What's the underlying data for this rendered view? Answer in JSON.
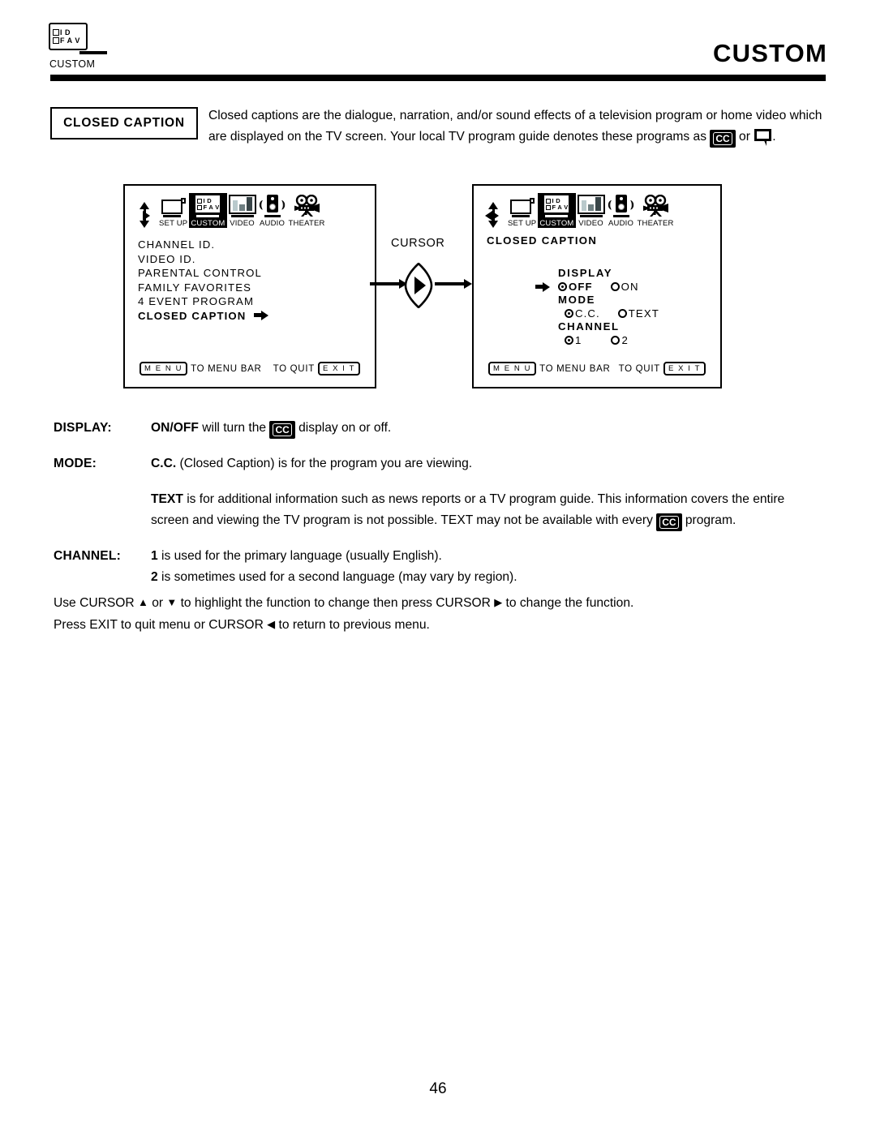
{
  "header": {
    "icon_name": "custom-tv-icon",
    "icon_rows": [
      {
        "label": "I D"
      },
      {
        "label": "F A V"
      }
    ],
    "icon_caption": "CUSTOM",
    "title": "CUSTOM"
  },
  "intro": {
    "tag_label": "CLOSED CAPTION",
    "text_part1": "Closed captions are the dialogue, narration, and/or sound effects of a television program or home video which are displayed on the TV screen.  Your local TV program guide denotes these programs as ",
    "cc_badge": "CC",
    "text_part2": " or ",
    "text_part3": "."
  },
  "menu_bar": {
    "items": [
      {
        "label": "SET UP",
        "icon": "tv-setup-icon",
        "selected": false
      },
      {
        "label": "CUSTOM",
        "icon": "custom-tv-icon",
        "selected": true
      },
      {
        "label": "VIDEO",
        "icon": "video-bars-icon",
        "selected": false
      },
      {
        "label": "AUDIO",
        "icon": "speaker-icon",
        "selected": false
      },
      {
        "label": "THEATER",
        "icon": "film-projector-icon",
        "selected": false
      }
    ],
    "cursor_pad_icon": "cursor-pad-icon"
  },
  "screen_left": {
    "name": "custom-menu-screen",
    "rows": [
      {
        "label": "CHANNEL ID.",
        "current": false,
        "arrow": false
      },
      {
        "label": "VIDEO ID.",
        "current": false,
        "arrow": false
      },
      {
        "label": "PARENTAL CONTROL",
        "current": false,
        "arrow": false
      },
      {
        "label": "FAMILY FAVORITES",
        "current": false,
        "arrow": false
      },
      {
        "label": "4 EVENT PROGRAM",
        "current": false,
        "arrow": false
      },
      {
        "label": "CLOSED CAPTION",
        "current": true,
        "arrow": true
      }
    ],
    "bottom": {
      "menu_key": "M E N U",
      "menu_text": "TO MENU BAR",
      "quit_text": "TO QUIT",
      "exit_key": "E X I T"
    }
  },
  "transition": {
    "label": "CURSOR",
    "lens_icon": "cursor-right-lens-icon",
    "arrow_in": "arrow-right-icon",
    "arrow_out": "arrow-right-icon"
  },
  "screen_right": {
    "name": "closed-caption-settings-screen",
    "title": "CLOSED CAPTION",
    "groups": [
      {
        "label": "DISPLAY",
        "pointer": true,
        "options": [
          {
            "label": "OFF",
            "selected": true,
            "bold": true
          },
          {
            "label": "ON",
            "selected": false,
            "bold": false
          }
        ]
      },
      {
        "label": "MODE",
        "pointer": false,
        "options": [
          {
            "label": "C.C.",
            "selected": true,
            "bold": false
          },
          {
            "label": "TEXT",
            "selected": false,
            "bold": false
          }
        ]
      },
      {
        "label": "CHANNEL",
        "pointer": false,
        "options": [
          {
            "label": "1",
            "selected": true,
            "bold": false
          },
          {
            "label": "2",
            "selected": false,
            "bold": false
          }
        ]
      }
    ],
    "bottom": {
      "menu_key": "M E N U",
      "menu_text": "TO MENU BAR",
      "quit_text": "TO QUIT",
      "exit_key": "E X I T"
    }
  },
  "definitions": {
    "display": {
      "term": "DISPLAY:",
      "bold_lead": "ON/OFF",
      "text_before_badge": " will turn the ",
      "badge": "CC",
      "text_after_badge": " display on or off."
    },
    "mode": {
      "term": "MODE:",
      "bold_lead": "C.C.",
      "text": " (Closed Caption) is for the program you are viewing."
    },
    "text_paragraph": {
      "bold_lead": "TEXT",
      "text_before_badge": " is for additional information such as news reports or a TV program guide.  This information covers the entire screen and viewing the TV program is not possible.  TEXT may not be available with every ",
      "badge": "CC",
      "text_after_badge": " program."
    },
    "channel": {
      "term": "CHANNEL:",
      "line1_bold": "1",
      "line1_text": " is used for the primary language (usually English).",
      "line2_bold": "2",
      "line2_text": " is sometimes used for a second language (may vary by region)."
    }
  },
  "footer_notes": {
    "line1_a": "Use CURSOR ",
    "line1_up": "▲",
    "line1_b": " or ",
    "line1_down": "▼",
    "line1_c": " to highlight the function to change then press CURSOR ",
    "line1_right": "▶",
    "line1_d": " to change the function.",
    "line2_a": "Press EXIT to quit menu or CURSOR ",
    "line2_left": "◀",
    "line2_b": " to return to previous menu."
  },
  "page_number": "46",
  "colors": {
    "ink": "#000000",
    "paper": "#ffffff",
    "video_bar_light": "#b9c9cc",
    "video_bar_mid": "#6f7f82",
    "video_bar_dark": "#394548"
  }
}
